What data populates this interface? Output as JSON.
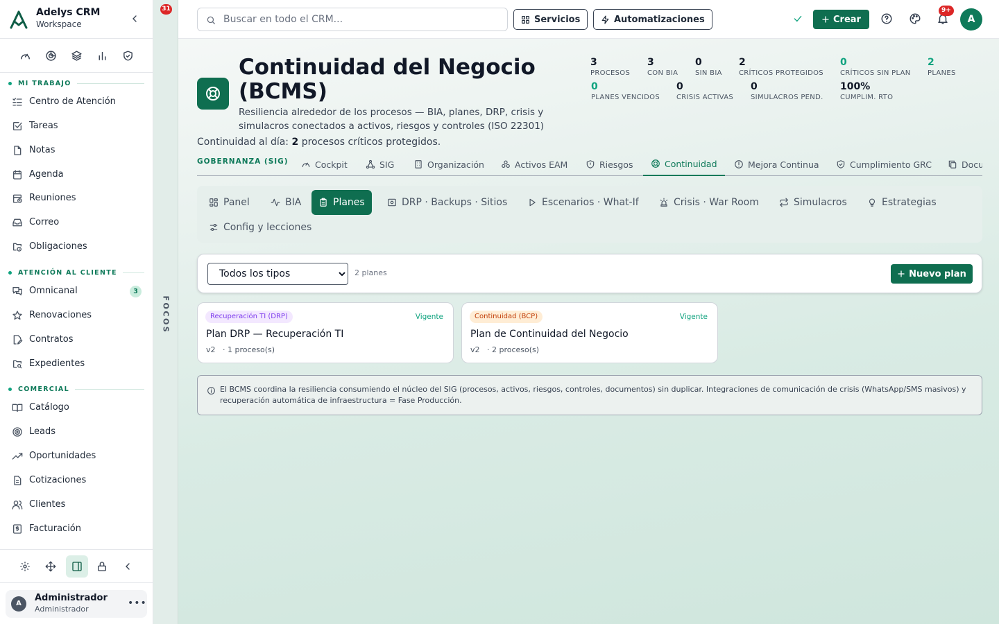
{
  "app": {
    "name": "Adelys CRM",
    "workspace": "Workspace"
  },
  "sidebar": {
    "sections": [
      {
        "label": "MI TRABAJO"
      },
      {
        "label": "ATENCIÓN AL CLIENTE"
      },
      {
        "label": "COMERCIAL"
      }
    ],
    "items": [
      {
        "label": "Centro de Atención",
        "icon": "list-check-icon"
      },
      {
        "label": "Tareas",
        "icon": "square-check-icon"
      },
      {
        "label": "Notas",
        "icon": "file-icon"
      },
      {
        "label": "Agenda",
        "icon": "calendar-icon"
      },
      {
        "label": "Reuniones",
        "icon": "calendar-clock-icon"
      },
      {
        "label": "Correo",
        "icon": "inbox-icon"
      },
      {
        "label": "Obligaciones",
        "icon": "folder-clock-icon"
      },
      {
        "label": "Omnicanal",
        "icon": "messages-icon",
        "badge": "3"
      },
      {
        "label": "Renovaciones",
        "icon": "star-icon"
      },
      {
        "label": "Contratos",
        "icon": "file-signature-icon"
      },
      {
        "label": "Expedientes",
        "icon": "folder-search-icon"
      },
      {
        "label": "Catálogo",
        "icon": "book-open-icon"
      },
      {
        "label": "Leads",
        "icon": "target-icon"
      },
      {
        "label": "Oportunidades",
        "icon": "trending-up-icon"
      },
      {
        "label": "Cotizaciones",
        "icon": "receipt-icon"
      },
      {
        "label": "Clientes",
        "icon": "users-icon"
      },
      {
        "label": "Facturación",
        "icon": "invoice-dollar-icon"
      }
    ],
    "user": {
      "name": "Administrador",
      "role": "Administrador",
      "initial": "A"
    }
  },
  "focos": {
    "label": "FOCOS",
    "count": "31"
  },
  "topbar": {
    "search_placeholder": "Buscar en todo el CRM...",
    "servicios": "Servicios",
    "automatizaciones": "Automatizaciones",
    "crear": "Crear",
    "notif_badge": "9+",
    "avatar_initial": "A"
  },
  "header": {
    "title": "Continuidad del Negocio (BCMS)",
    "subtitle": "Resiliencia alrededor de los procesos — BIA, planes, DRP, crisis y simulacros conectados a activos, riesgos y controles (ISO 22301)",
    "day_prefix": "Continuidad al día:",
    "day_count": "2",
    "day_suffix": "procesos críticos protegidos."
  },
  "kpis": [
    {
      "value": "3",
      "label": "PROCESOS",
      "green": false
    },
    {
      "value": "3",
      "label": "CON BIA",
      "green": false
    },
    {
      "value": "0",
      "label": "SIN BIA",
      "green": false
    },
    {
      "value": "2",
      "label": "CRÍTICOS PROTEGIDOS",
      "green": false
    },
    {
      "value": "0",
      "label": "CRÍTICOS SIN PLAN",
      "green": true
    },
    {
      "value": "2",
      "label": "PLANES",
      "green": true
    },
    {
      "value": "0",
      "label": "PLANES VENCIDOS",
      "green": true
    },
    {
      "value": "0",
      "label": "CRISIS ACTIVAS",
      "green": false
    },
    {
      "value": "0",
      "label": "SIMULACROS PEND.",
      "green": false
    },
    {
      "value": "100%",
      "label": "CUMPLIM. RTO",
      "green": false
    }
  ],
  "module_tabs": {
    "group_label": "GOBERNANZA (SIG)",
    "tabs": [
      {
        "label": "Cockpit",
        "icon": "gauge-icon"
      },
      {
        "label": "SIG",
        "icon": "network-icon"
      },
      {
        "label": "Organización",
        "icon": "building-icon"
      },
      {
        "label": "Activos EAM",
        "icon": "cogs-icon"
      },
      {
        "label": "Riesgos",
        "icon": "shield-icon"
      },
      {
        "label": "Continuidad",
        "icon": "life-buoy-icon",
        "active": true
      },
      {
        "label": "Mejora Continua",
        "icon": "alert-circle-icon"
      },
      {
        "label": "Cumplimiento GRC",
        "icon": "shield-check-icon"
      },
      {
        "label": "Docu",
        "icon": "copy-icon"
      }
    ]
  },
  "sub_tabs": [
    {
      "label": "Panel",
      "icon": "grid-icon"
    },
    {
      "label": "BIA",
      "icon": "activity-icon"
    },
    {
      "label": "Planes",
      "icon": "clipboard-icon",
      "active": true
    },
    {
      "label": "DRP · Backups · Sitios",
      "icon": "hard-drive-icon"
    },
    {
      "label": "Escenarios · What-If",
      "icon": "play-icon"
    },
    {
      "label": "Crisis · War Room",
      "icon": "siren-icon"
    },
    {
      "label": "Simulacros",
      "icon": "repeat-icon"
    },
    {
      "label": "Estrategias",
      "icon": "lightbulb-icon"
    },
    {
      "label": "Config y lecciones",
      "icon": "sliders-icon"
    }
  ],
  "filter": {
    "type_selected": "Todos los tipos",
    "count_label": "2 planes",
    "new_plan": "Nuevo plan"
  },
  "plans": [
    {
      "tag": "Recuperación TI (DRP)",
      "status": "Vigente",
      "title": "Plan DRP — Recuperación TI",
      "meta": "v2   · 1 proceso(s)",
      "tag_color": "#7c3aed",
      "tag_bg": "#f3e8ff"
    },
    {
      "tag": "Continuidad (BCP)",
      "status": "Vigente",
      "title": "Plan de Continuidad del Negocio",
      "meta": "v2   · 2 proceso(s)",
      "tag_color": "#c2410c",
      "tag_bg": "#ffedd5"
    }
  ],
  "info_note": "El BCMS coordina la resiliencia consumiendo el núcleo del SIG (procesos, activos, riesgos, controles, documentos) sin duplicar. Integraciones de comunicación de crisis (WhatsApp/SMS masivos) y recuperación automática de infraestructura = Fase Producción.",
  "colors": {
    "accent": "#0f6e50",
    "accent_light": "#10a37f",
    "danger": "#dc2626"
  }
}
